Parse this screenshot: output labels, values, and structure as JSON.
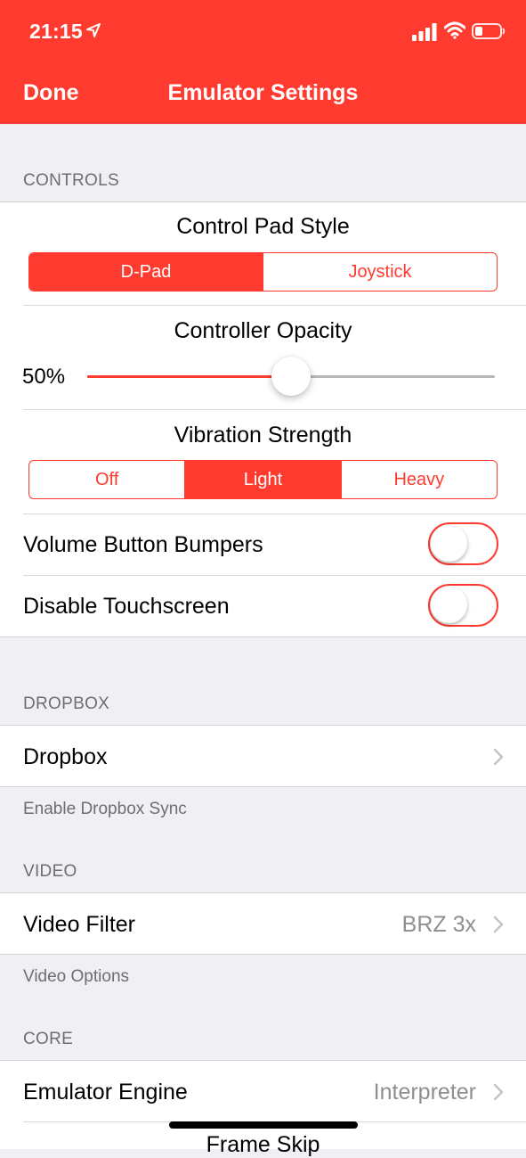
{
  "status_bar": {
    "time": "21:15",
    "icons": [
      "location-arrow-icon",
      "signal-bars-icon",
      "wifi-icon",
      "battery-low-icon"
    ]
  },
  "nav": {
    "done_label": "Done",
    "title": "Emulator Settings"
  },
  "colors": {
    "accent": "#ff3b30",
    "background": "#efeff4",
    "secondary_text": "#8e8e93"
  },
  "controls": {
    "header": "CONTROLS",
    "control_pad_style": {
      "label": "Control Pad Style",
      "options": [
        "D-Pad",
        "Joystick"
      ],
      "selected": "D-Pad"
    },
    "controller_opacity": {
      "label": "Controller Opacity",
      "value_text": "50%",
      "value": 0.5
    },
    "vibration_strength": {
      "label": "Vibration Strength",
      "options": [
        "Off",
        "Light",
        "Heavy"
      ],
      "selected": "Light"
    },
    "volume_button_bumpers": {
      "label": "Volume Button Bumpers",
      "on": false
    },
    "disable_touchscreen": {
      "label": "Disable Touchscreen",
      "on": false
    }
  },
  "dropbox": {
    "header": "DROPBOX",
    "row_label": "Dropbox",
    "footer": "Enable Dropbox Sync"
  },
  "video": {
    "header": "VIDEO",
    "row_label": "Video Filter",
    "row_value": "BRZ 3x",
    "footer": "Video Options"
  },
  "core": {
    "header": "CORE",
    "row_label": "Emulator Engine",
    "row_value": "Interpreter",
    "next_row_label_partial": "Frame Skip"
  }
}
